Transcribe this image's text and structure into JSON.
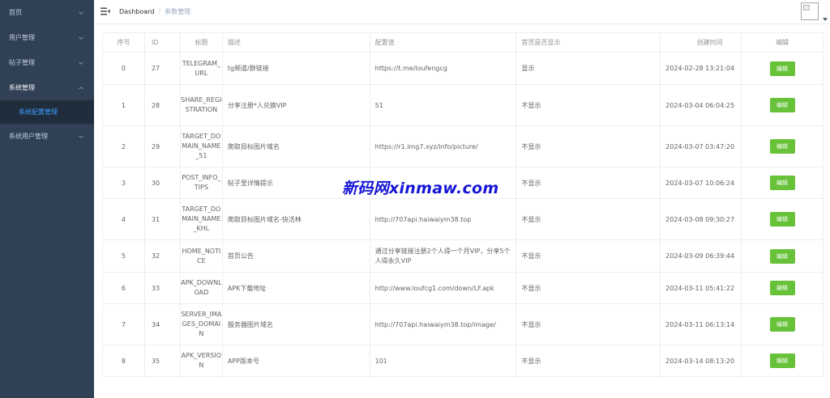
{
  "sidebar": {
    "items": [
      {
        "label": "首页"
      },
      {
        "label": "用户管理"
      },
      {
        "label": "帖子管理"
      },
      {
        "label": "系统管理"
      },
      {
        "label": "系统配置管理"
      },
      {
        "label": "系统用户管理"
      }
    ],
    "colors": {
      "bg": "#304156",
      "text": "#bfcbd9",
      "submenu_bg": "#1f2d3d",
      "active": "#409eff"
    }
  },
  "header": {
    "breadcrumb": {
      "home": "Dashboard",
      "separator": "/",
      "current": "参数管理"
    }
  },
  "table": {
    "columns": [
      "序号",
      "ID",
      "标题",
      "描述",
      "配置值",
      "首页是否显示",
      "创建时间",
      "编辑"
    ],
    "rows": [
      {
        "index": "0",
        "id": "27",
        "title": "TELEGRAM_URL",
        "desc": "tg频道/群链接",
        "value": "https://t.me/loufengcg",
        "show": "显示",
        "time": "2024-02-28 13:21:04",
        "action": "编辑"
      },
      {
        "index": "1",
        "id": "28",
        "title": "SHARE_REGISTRATION",
        "desc": "分享注册*人兑换VIP",
        "value": "51",
        "show": "不显示",
        "time": "2024-03-04 06:04:25",
        "action": "编辑"
      },
      {
        "index": "2",
        "id": "29",
        "title": "TARGET_DOMAIN_NAME_51",
        "desc": "爬取目标图片域名",
        "value": "https://r1.img7.xyz/info/picture/",
        "show": "不显示",
        "time": "2024-03-07 03:47:20",
        "action": "编辑"
      },
      {
        "index": "3",
        "id": "30",
        "title": "POST_INFO_TIPS",
        "desc": "帖子里详情提示",
        "value": "",
        "show": "不显示",
        "time": "2024-03-07 10:06:24",
        "action": "编辑"
      },
      {
        "index": "4",
        "id": "31",
        "title": "TARGET_DOMAIN_NAME_KHL",
        "desc": "爬取目标图片域名-快活林",
        "value": "http://707api.haiwaiym38.top",
        "show": "不显示",
        "time": "2024-03-08 09:30:27",
        "action": "编辑"
      },
      {
        "index": "5",
        "id": "32",
        "title": "HOME_NOTICE",
        "desc": "首页公告",
        "value": "通过分享链接注册2个人得一个月VIP，分享5个人得永久VIP",
        "show": "不显示",
        "time": "2024-03-09 06:39:44",
        "action": "编辑"
      },
      {
        "index": "6",
        "id": "33",
        "title": "APK_DOWNLOAD",
        "desc": "APK下载地址",
        "value": "http://www.loufcg1.com/down/LF.apk",
        "show": "不显示",
        "time": "2024-03-11 05:41:22",
        "action": "编辑"
      },
      {
        "index": "7",
        "id": "34",
        "title": "SERVER_IMAGES_DOMAIN",
        "desc": "服务器图片域名",
        "value": "http://707api.haiwaiym38.top/image/",
        "show": "不显示",
        "time": "2024-03-11 06:13:14",
        "action": "编辑"
      },
      {
        "index": "8",
        "id": "35",
        "title": "APK_VERSION",
        "desc": "APP版本号",
        "value": "101",
        "show": "不显示",
        "time": "2024-03-14 08:13:20",
        "action": "编辑"
      }
    ],
    "colors": {
      "header_text": "#909399",
      "cell_text": "#606266",
      "border": "#ebeef5",
      "edit_button": "#67c23a"
    }
  },
  "watermark": {
    "text": "新码网xinmaw.com",
    "color": "#1616d6"
  }
}
